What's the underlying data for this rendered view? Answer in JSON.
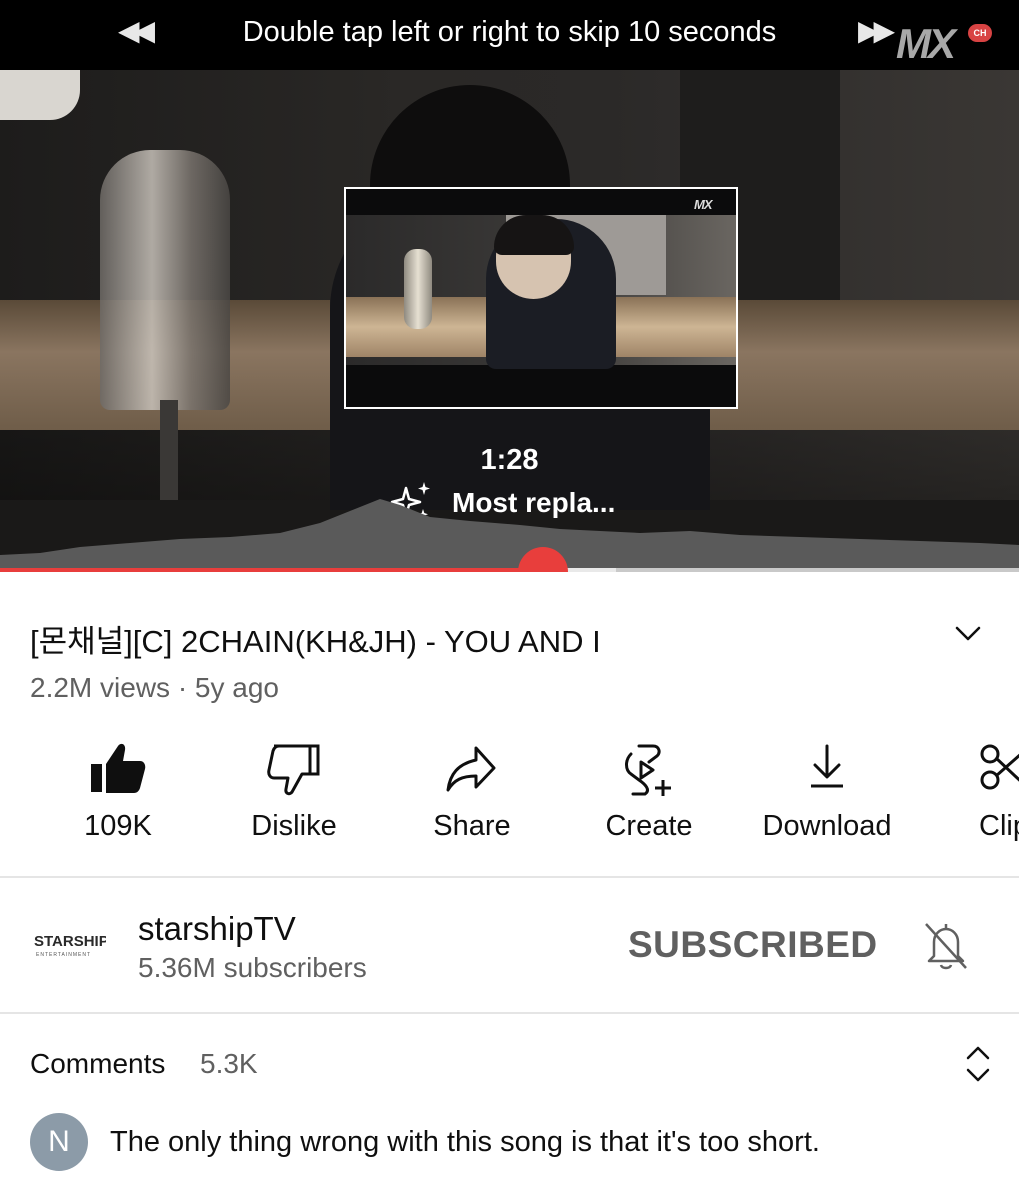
{
  "player": {
    "skip_hint": "Double tap left or right to skip 10 seconds",
    "skip_back_glyph": "◀◀",
    "skip_forward_glyph": "▶▶",
    "watermark": "MX",
    "watermark_badge": "CH",
    "preview_watermark": "MX",
    "scrub_time": "1:28",
    "replay_label": "Most repla...",
    "progress_fraction": 0.533,
    "buffer_fraction": 0.605,
    "accent_color": "#e83e3c",
    "icons": [
      "sparkle-icon"
    ]
  },
  "video": {
    "title": "[몬채널][C] 2CHAIN(KH&JH) - YOU AND I",
    "meta": "2.2M views · 5y ago"
  },
  "actions": [
    {
      "name": "like",
      "label": "109K",
      "icon": "thumbs-up-filled-icon"
    },
    {
      "name": "dislike",
      "label": "Dislike",
      "icon": "thumbs-down-icon"
    },
    {
      "name": "share",
      "label": "Share",
      "icon": "share-arrow-icon"
    },
    {
      "name": "create",
      "label": "Create",
      "icon": "create-remix-icon"
    },
    {
      "name": "download",
      "label": "Download",
      "icon": "download-icon"
    },
    {
      "name": "clip",
      "label": "Clip",
      "icon": "scissors-icon"
    }
  ],
  "channel": {
    "logo_text": "STARSHIP",
    "logo_subtext": "ENTERTAINMENT",
    "name": "starshipTV",
    "subscribers": "5.36M subscribers",
    "subscribe_label": "SUBSCRIBED",
    "bell_icon": "bell-off-icon"
  },
  "comments": {
    "label": "Comments",
    "count": "5.3K",
    "sort_icon": "unfold-icon",
    "top_comment": {
      "avatar_letter": "N",
      "avatar_color": "#8c9ba8",
      "text": "The only thing wrong with this song is that it's too short."
    }
  }
}
